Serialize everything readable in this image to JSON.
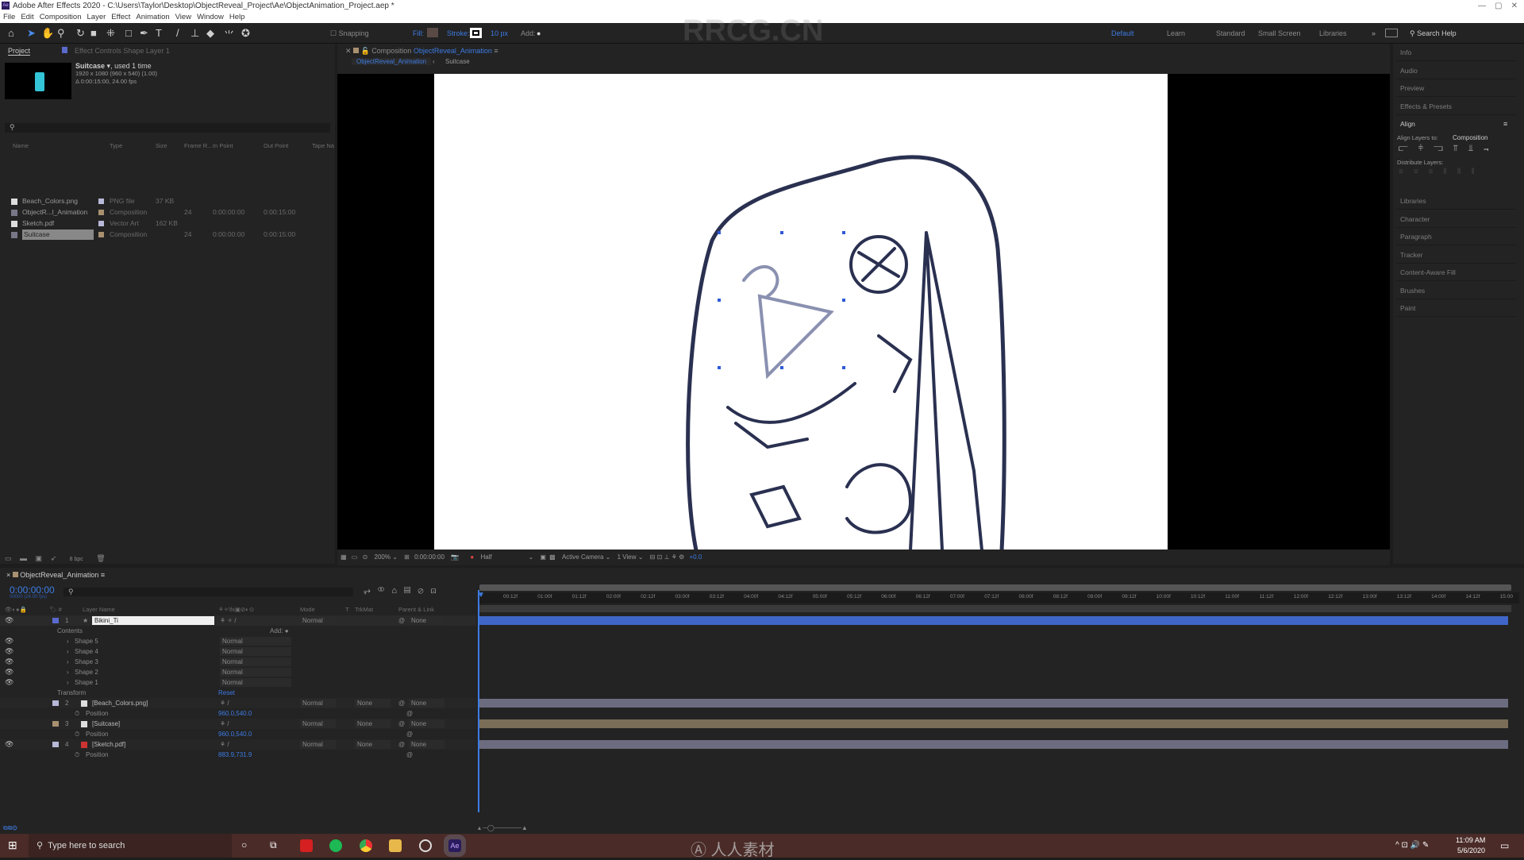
{
  "window": {
    "title": "Adobe After Effects 2020 - C:\\Users\\Taylor\\Desktop\\ObjectReveal_Project\\Ae\\ObjectAnimation_Project.aep *",
    "app_icon": "Ae"
  },
  "menu": [
    "File",
    "Edit",
    "Composition",
    "Layer",
    "Effect",
    "Animation",
    "View",
    "Window",
    "Help"
  ],
  "toolbar": {
    "snapping": "Snapping",
    "fill": "Fill:",
    "stroke": "Stroke:",
    "stroke_width": "10 px",
    "add": "Add:",
    "fill_color": "#5a4a46"
  },
  "workspaces": {
    "items": [
      "Default",
      "Learn",
      "Standard",
      "Small Screen",
      "Libraries"
    ],
    "active": "Default",
    "search": "Search Help"
  },
  "project": {
    "tab": "Project",
    "effect_tab": "Effect Controls Shape Layer 1",
    "preview_name": "Suitcase",
    "preview_used": ", used 1 time",
    "preview_dims": "1920 x 1080  (960 x 540) (1.00)",
    "preview_duration": "Δ 0:00:15:00, 24.00 fps",
    "columns": [
      "Name",
      "Type",
      "Size",
      "Frame R...",
      "In Point",
      "Out Point",
      "Tape Na"
    ],
    "items": [
      {
        "name": "Beach_Colors.png",
        "type": "PNG file",
        "size": "37 KB",
        "frame_rate": "",
        "in": "",
        "out": "",
        "label": "#b8b8d8"
      },
      {
        "name": "ObjectR...l_Animation",
        "type": "Composition",
        "size": "",
        "frame_rate": "24",
        "in": "0:00:00:00",
        "out": "0:00:15:00",
        "label": "#a89070"
      },
      {
        "name": "Sketch.pdf",
        "type": "Vector Art",
        "size": "162 KB",
        "frame_rate": "",
        "in": "",
        "out": "",
        "label": "#b8b8d8"
      },
      {
        "name": "Suitcase",
        "type": "Composition",
        "size": "",
        "frame_rate": "24",
        "in": "0:00:00:00",
        "out": "0:00:15:00",
        "label": "#a89070"
      }
    ],
    "bpc": "8 bpc"
  },
  "composition": {
    "tab": "Composition",
    "name": "ObjectReveal_Animation",
    "breadcrumb": [
      "ObjectReveal_Animation",
      "Suitcase"
    ]
  },
  "viewer_bar": {
    "zoom": "200%",
    "timecode": "0:00:00:00",
    "resolution": "Half",
    "camera": "Active Camera",
    "views": "1 View",
    "exposure": "+0.0"
  },
  "right_panel": {
    "items_top": [
      "Info",
      "Audio",
      "Preview",
      "Effects & Presets"
    ],
    "align": {
      "title": "Align",
      "align_to_label": "Align Layers to:",
      "align_to": "Composition",
      "distribute": "Distribute Layers:"
    },
    "items_bottom": [
      "Libraries",
      "Character",
      "Paragraph",
      "Tracker",
      "Content-Aware Fill",
      "Brushes",
      "Paint"
    ]
  },
  "timeline": {
    "tab": "ObjectReveal_Animation",
    "timecode": "0:00:00:00",
    "fps_sub": "00000 (24.00 fps)",
    "columns": {
      "layer_name": "Layer Name",
      "mode": "Mode",
      "t": "T",
      "trkmat": "TrkMat",
      "parent": "Parent & Link"
    },
    "ruler": [
      "00:12f",
      "01:00f",
      "01:12f",
      "02:00f",
      "02:12f",
      "03:00f",
      "03:12f",
      "04:00f",
      "04:12f",
      "05:00f",
      "05:12f",
      "06:00f",
      "06:12f",
      "07:00f",
      "07:12f",
      "08:00f",
      "08:12f",
      "09:00f",
      "09:12f",
      "10:00f",
      "10:12f",
      "11:00f",
      "11:12f",
      "12:00f",
      "12:12f",
      "13:00f",
      "13:12f",
      "14:00f",
      "14:12f",
      "15:00"
    ],
    "layer1": {
      "num": "1",
      "name": "Bikini_Ti",
      "mode": "Normal",
      "parent": "None",
      "contents": "Contents",
      "add": "Add:",
      "shapes": [
        {
          "name": "Shape 5",
          "mode": "Normal"
        },
        {
          "name": "Shape 4",
          "mode": "Normal"
        },
        {
          "name": "Shape 3",
          "mode": "Normal"
        },
        {
          "name": "Shape 2",
          "mode": "Normal"
        },
        {
          "name": "Shape 1",
          "mode": "Normal"
        }
      ],
      "transform": "Transform",
      "reset": "Reset"
    },
    "layers": [
      {
        "num": "2",
        "name": "[Beach_Colors.png]",
        "mode": "Normal",
        "trkmat": "None",
        "parent": "None",
        "prop": "Position",
        "value": "960.0,540.0",
        "label": "#b8b8d8",
        "bar": "#6c6c80"
      },
      {
        "num": "3",
        "name": "[Suitcase]",
        "mode": "Normal",
        "trkmat": "None",
        "parent": "None",
        "prop": "Position",
        "value": "960.0,540.0",
        "label": "#a89070",
        "bar": "#7a6e58"
      },
      {
        "num": "4",
        "name": "[Sketch.pdf]",
        "mode": "Normal",
        "trkmat": "None",
        "parent": "None",
        "prop": "Position",
        "value": "883.9,731.9",
        "label": "#b8b8d8",
        "bar": "#6c6c80"
      }
    ]
  },
  "taskbar": {
    "search": "Type here to search",
    "time": "11:09 AM",
    "date": "5/6/2020"
  },
  "watermark": "RRCG.CN"
}
